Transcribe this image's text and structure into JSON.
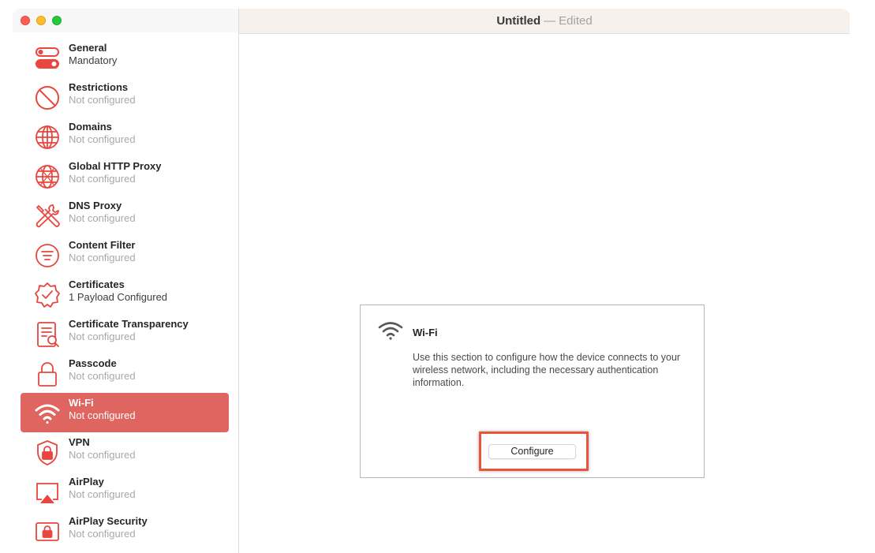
{
  "window": {
    "title": "Untitled",
    "separator": "—",
    "status": "Edited"
  },
  "sidebar": {
    "items": [
      {
        "label": "General",
        "status": "Mandatory",
        "icon": "toggle-icon"
      },
      {
        "label": "Restrictions",
        "status": "Not configured",
        "icon": "prohibited-icon"
      },
      {
        "label": "Domains",
        "status": "Not configured",
        "icon": "globe-icon"
      },
      {
        "label": "Global HTTP Proxy",
        "status": "Not configured",
        "icon": "globe-network-icon"
      },
      {
        "label": "DNS Proxy",
        "status": "Not configured",
        "icon": "tools-icon"
      },
      {
        "label": "Content Filter",
        "status": "Not configured",
        "icon": "filter-icon"
      },
      {
        "label": "Certificates",
        "status": "1 Payload Configured",
        "icon": "certificate-badge-icon"
      },
      {
        "label": "Certificate Transparency",
        "status": "Not configured",
        "icon": "document-search-icon"
      },
      {
        "label": "Passcode",
        "status": "Not configured",
        "icon": "lock-icon"
      },
      {
        "label": "Wi-Fi",
        "status": "Not configured",
        "icon": "wifi-icon",
        "selected": true
      },
      {
        "label": "VPN",
        "status": "Not configured",
        "icon": "shield-lock-icon"
      },
      {
        "label": "AirPlay",
        "status": "Not configured",
        "icon": "airplay-icon"
      },
      {
        "label": "AirPlay Security",
        "status": "Not configured",
        "icon": "airplay-lock-icon"
      }
    ]
  },
  "panel": {
    "title": "Wi-Fi",
    "icon": "wifi-icon",
    "description": "Use this section to configure how the device connects to your wireless network, including the necessary authentication information.",
    "button_label": "Configure"
  },
  "colors": {
    "accent": "#df6560",
    "icon_red": "#e8463f",
    "highlight": "#e8553d"
  }
}
